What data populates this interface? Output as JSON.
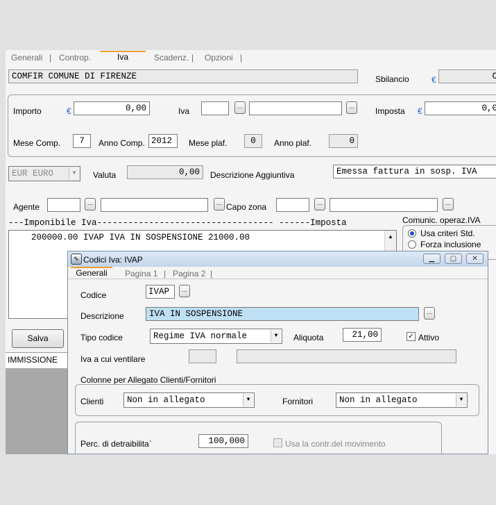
{
  "tabs": [
    "Generali",
    "Controp.",
    "Iva",
    "Scadenz.",
    "Opzioni"
  ],
  "header": {
    "ditta": "COMFIR    COMUNE DI FIRENZE",
    "sbilancio_label": "Sbilancio",
    "sbilancio_value": "C"
  },
  "importo": {
    "label": "Importo",
    "value": "0,00",
    "iva_label": "Iva",
    "imposta_label": "Imposta",
    "imposta_value": "0,0"
  },
  "mese": {
    "mese_comp_label": "Mese Comp.",
    "mese_comp": "7",
    "anno_comp_label": "Anno Comp.",
    "anno_comp": "2012",
    "mese_plaf_label": "Mese plaf.",
    "mese_plaf": "0",
    "anno_plaf_label": "Anno plaf.",
    "anno_plaf": "0"
  },
  "valuta": {
    "currency": "EUR EURO",
    "label": "Valuta",
    "value": "0,00",
    "descr_label": "Descrizione Aggiuntiva",
    "descr_value": "Emessa fattura in sosp. IVA"
  },
  "agente": {
    "label": "Agente",
    "capo_zona_label": "Capo zona"
  },
  "imponibile": {
    "header": "---Imponibile Iva---------------------------------- ------Imposta",
    "row": "200000.00 IVAP IVA IN SOSPENSIONE                21000.00"
  },
  "comunic": {
    "title": "Comunic. operaz.IVA",
    "opt1": "Usa criteri Std.",
    "opt2": "Forza inclusione"
  },
  "salva_label": "Salva",
  "immissione": "IMMISSIONE",
  "icons": [
    "ellipsis-icon",
    "dropdown-arrow-icon",
    "dialog-app-icon",
    "minimize-icon",
    "maximize-icon",
    "close-icon"
  ],
  "dialog": {
    "title": "Codici Iva: IVAP",
    "tabs": [
      "Generali",
      "Pagina 1",
      "Pagina 2"
    ],
    "codice_label": "Codice",
    "codice": "IVAP",
    "descrizione_label": "Descrizione",
    "descrizione": "IVA IN SOSPENSIONE",
    "tipo_label": "Tipo codice",
    "tipo": "Regime IVA normale",
    "aliquota_label": "Aliquota",
    "aliquota": "21,00",
    "attivo_label": "Attivo",
    "attivo_checked": true,
    "ventilare_label": "Iva a cui ventilare",
    "colonne_title": "Colonne per Allegato Clienti/Fornitori",
    "clienti_label": "Clienti",
    "clienti": "Non in allegato",
    "fornitori_label": "Fornitori",
    "fornitori": "Non in allegato",
    "perc_label": "Perc. di detraibilita`",
    "perc": "100,000",
    "usa_contr_label": "Usa la contr.del movimento"
  },
  "colors": {
    "accent_tab": "#f0a030",
    "euro": "#1e5fd0",
    "highlight_field": "#bfe0f4"
  }
}
